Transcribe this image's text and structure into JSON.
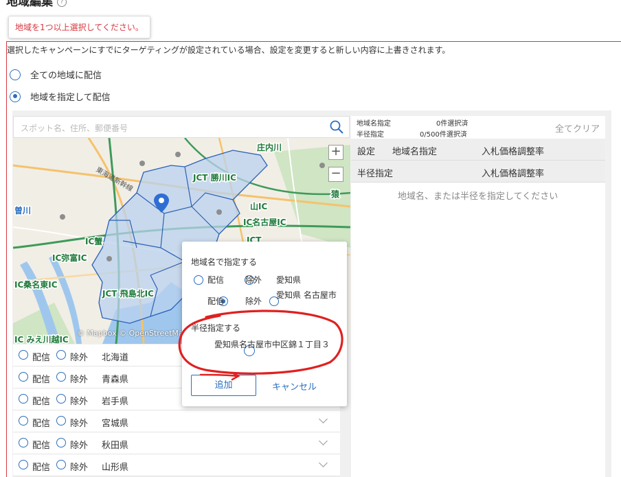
{
  "header": {
    "title": "地域編集"
  },
  "error_tooltip": "地域を1つ以上選択してください。",
  "notice": "選択したキャンペーンにすでにターゲティングが設定されている場合、設定を変更すると新しい内容に上書きされます。",
  "mode_options": [
    {
      "label": "全ての地域に配信",
      "selected": false
    },
    {
      "label": "地域を指定して配信",
      "selected": true
    }
  ],
  "search": {
    "placeholder": "スポット名、住所、郵便番号"
  },
  "map": {
    "zoom_in": "+",
    "zoom_out": "−",
    "attribution": "© Mapbox © OpenStreetMap",
    "labels": [
      "庄内川",
      "勝川IC",
      "東海道新幹線",
      "弥富IC",
      "桑名東IC",
      "名古屋IC",
      "JCT",
      "曽川",
      "みえ川越IC",
      "飛島北IC",
      "蟹",
      "山IC",
      "猿"
    ]
  },
  "prefectures": [
    {
      "deliver": "配信",
      "exclude": "除外",
      "name": "北海道"
    },
    {
      "deliver": "配信",
      "exclude": "除外",
      "name": "青森県"
    },
    {
      "deliver": "配信",
      "exclude": "除外",
      "name": "岩手県"
    },
    {
      "deliver": "配信",
      "exclude": "除外",
      "name": "宮城県"
    },
    {
      "deliver": "配信",
      "exclude": "除外",
      "name": "秋田県"
    },
    {
      "deliver": "配信",
      "exclude": "除外",
      "name": "山形県"
    }
  ],
  "right_panel": {
    "region_count_label": "地域名指定",
    "region_count_value": "0件選択済",
    "radius_count_label": "半径指定",
    "radius_count_value": "0/500件選択済",
    "clear_all": "全てクリア",
    "table1": {
      "col1": "設定",
      "col2": "地域名指定",
      "col3": "入札価格調整率"
    },
    "table2": {
      "col1": "半径指定",
      "col3": "入札価格調整率"
    },
    "empty_message": "地域名、または半径を指定してください"
  },
  "popup": {
    "region_section": "地域名で指定する",
    "region_rows": [
      {
        "deliver": "配信",
        "exclude": "除外",
        "name": "愛知県",
        "deliver_selected": false
      },
      {
        "deliver": "配信",
        "exclude": "除外",
        "name": "愛知県 名古屋市",
        "deliver_selected": true
      }
    ],
    "radius_section": "半径指定する",
    "radius_address": "愛知県名古屋市中区錦１丁目３",
    "add_button": "追加",
    "cancel_button": "キャンセル"
  },
  "colors": {
    "accent": "#2a6ebf",
    "error": "#d9363e",
    "annotation": "#e02020"
  }
}
